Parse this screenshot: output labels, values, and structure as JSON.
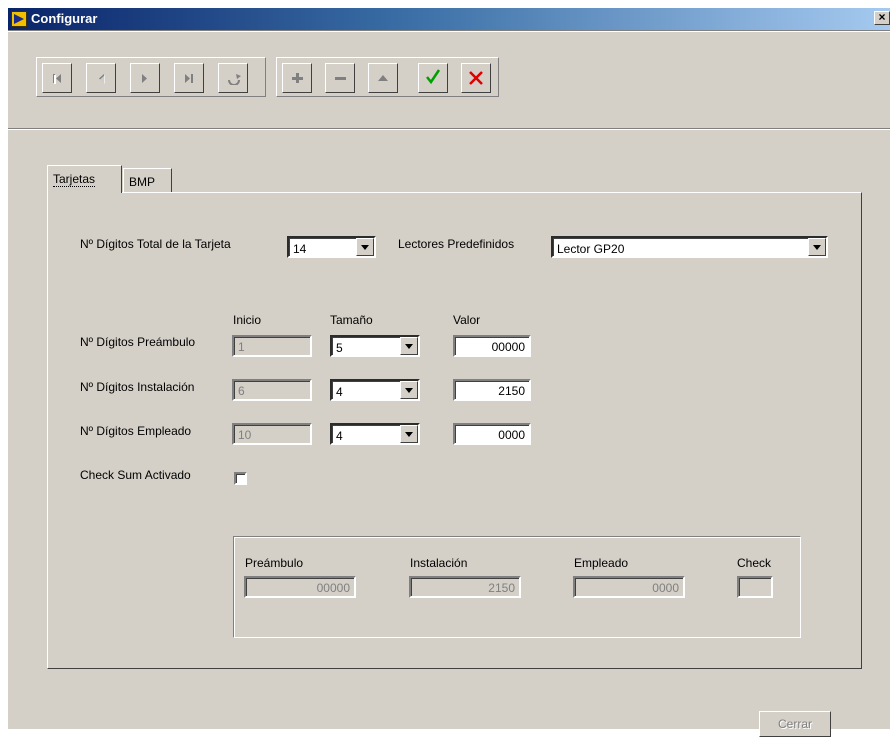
{
  "window": {
    "title": "Configurar",
    "close_glyph": "×"
  },
  "toolbar": {
    "buttons": [
      {
        "name": "first-record-button",
        "icon": "first-icon",
        "enabled": false
      },
      {
        "name": "prior-record-button",
        "icon": "prior-icon",
        "enabled": false
      },
      {
        "name": "next-record-button",
        "icon": "next-icon",
        "enabled": false
      },
      {
        "name": "last-record-button",
        "icon": "last-icon",
        "enabled": false
      },
      {
        "name": "refresh-button",
        "icon": "refresh-icon",
        "enabled": false
      },
      {
        "name": "insert-button",
        "icon": "plus-icon",
        "enabled": false
      },
      {
        "name": "delete-button",
        "icon": "minus-icon",
        "enabled": false
      },
      {
        "name": "edit-button",
        "icon": "triangle-up-icon",
        "enabled": false
      },
      {
        "name": "post-button",
        "icon": "checkmark-icon",
        "enabled": true,
        "color": "#00a000"
      },
      {
        "name": "cancel-button",
        "icon": "x-icon",
        "enabled": true,
        "color": "#e00000"
      }
    ]
  },
  "tabs": [
    {
      "label": "Tarjetas",
      "active": true
    },
    {
      "label": "BMP",
      "active": false
    }
  ],
  "card": {
    "total_digits_label": "Nº Dígitos Total de la Tarjeta",
    "total_digits_value": "14",
    "readers_label": "Lectores Predefinidos",
    "readers_value": "Lector GP20",
    "columns": {
      "inicio": "Inicio",
      "tamano": "Tamaño",
      "valor": "Valor"
    },
    "rows": [
      {
        "label": "Nº Dígitos Preámbulo",
        "inicio": "1",
        "tamano": "5",
        "valor": "00000"
      },
      {
        "label": "Nº Dígitos Instalación",
        "inicio": "6",
        "tamano": "4",
        "valor": "2150"
      },
      {
        "label": "Nº Dígitos Empleado",
        "inicio": "10",
        "tamano": "4",
        "valor": "0000"
      }
    ],
    "checksum_label": "Check Sum Activado",
    "checksum_checked": false
  },
  "summary": {
    "preambulo_label": "Preámbulo",
    "preambulo_value": "00000",
    "instalacion_label": "Instalación",
    "instalacion_value": "2150",
    "empleado_label": "Empleado",
    "empleado_value": "0000",
    "check_label": "Check",
    "check_value": ""
  },
  "footer": {
    "close_label": "Cerrar"
  }
}
